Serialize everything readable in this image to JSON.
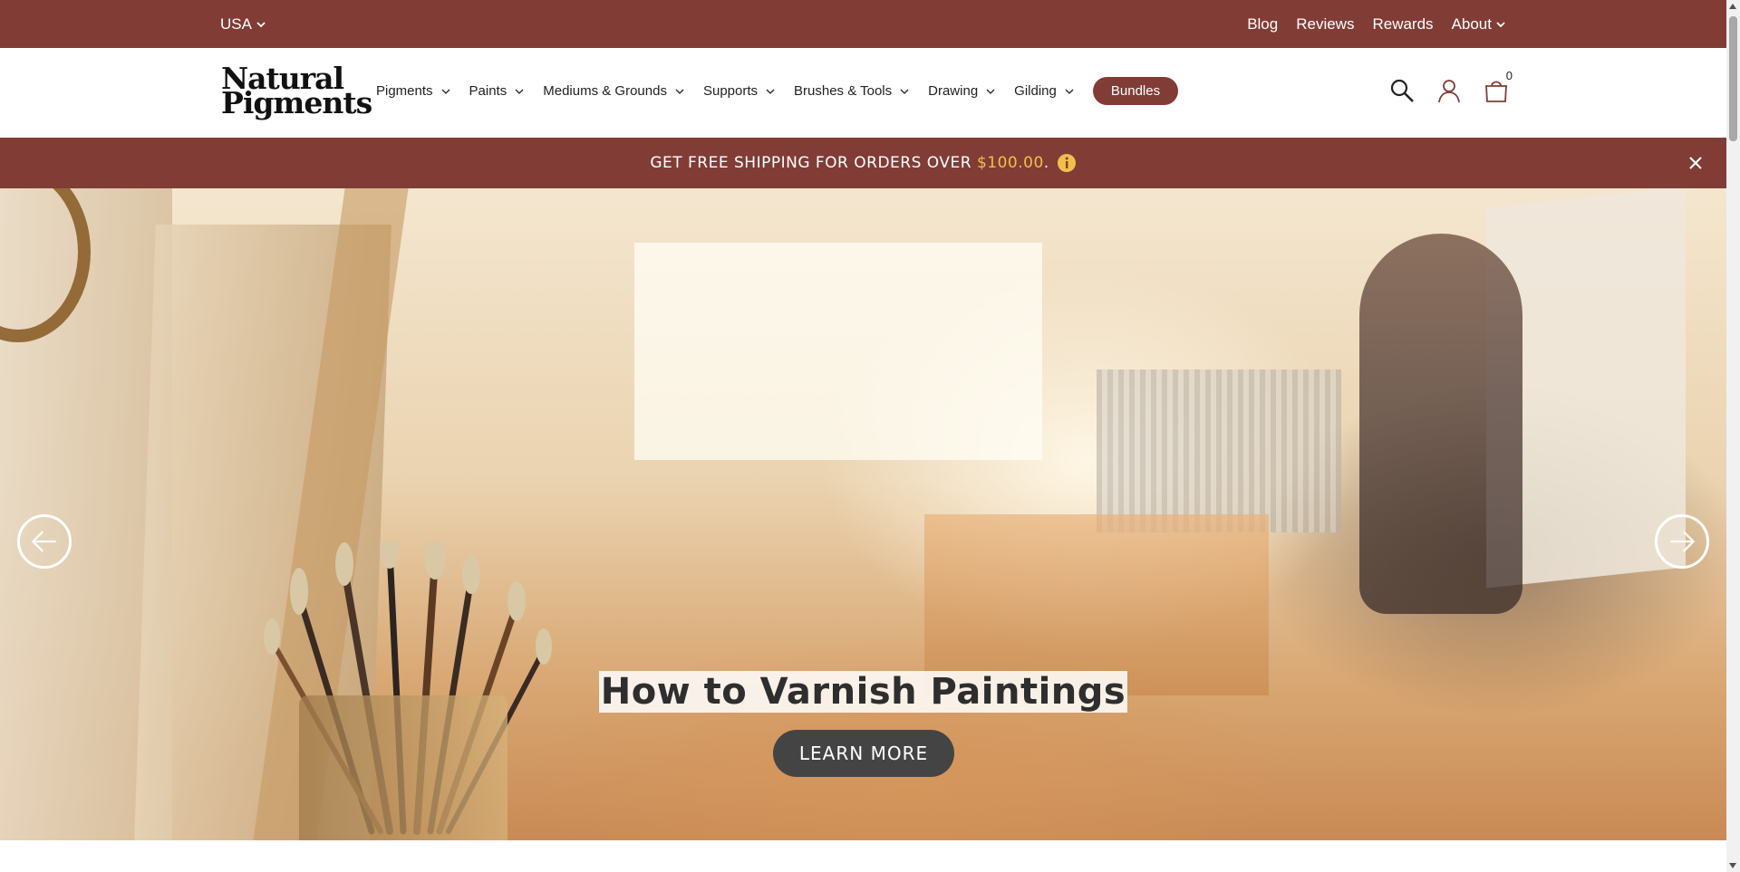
{
  "utility_bar": {
    "country": "USA",
    "links": [
      {
        "label": "Blog"
      },
      {
        "label": "Reviews"
      },
      {
        "label": "Rewards"
      },
      {
        "label": "About"
      }
    ],
    "background": "#813c36"
  },
  "header": {
    "logo_line1": "Natural",
    "logo_line2": "Pigments",
    "nav": [
      {
        "label": "Pigments"
      },
      {
        "label": "Paints"
      },
      {
        "label": "Mediums & Grounds"
      },
      {
        "label": "Supports"
      },
      {
        "label": "Brushes & Tools"
      },
      {
        "label": "Drawing"
      },
      {
        "label": "Gilding"
      }
    ],
    "bundles_label": "Bundles",
    "cart_count": "0",
    "icons": [
      "search-icon",
      "account-icon",
      "cart-icon"
    ]
  },
  "shipping_banner": {
    "text": "GET FREE SHIPPING FOR ORDERS OVER ",
    "amount": "$100.00",
    "suffix": ".",
    "accent": "#f0c04a"
  },
  "hero": {
    "title": "How to Varnish Paintings",
    "cta": "LEARN MORE"
  }
}
